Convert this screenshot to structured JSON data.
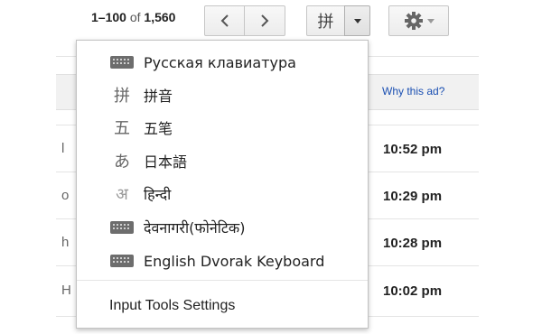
{
  "pager": {
    "range": "1–100",
    "of": "of",
    "total": "1,560"
  },
  "ime_button": {
    "glyph": "拼",
    "icon": "pinyin-ime-icon"
  },
  "settings_button": {
    "icon": "gear-icon"
  },
  "list": {
    "why_ad": "Why this ad?",
    "times": [
      "10:52 pm",
      "10:29 pm",
      "10:28 pm",
      "10:02 pm"
    ],
    "fragments": [
      "l",
      "o",
      "h",
      "H"
    ]
  },
  "menu": {
    "items": [
      {
        "icon": "keyboard-icon",
        "label": "Русская клавиатура"
      },
      {
        "icon": "pinyin-icon",
        "glyph": "拼",
        "label": "拼音"
      },
      {
        "icon": "wubi-icon",
        "glyph": "五",
        "label": "五笔"
      },
      {
        "icon": "hiragana-icon",
        "glyph": "あ",
        "label": "日本語"
      },
      {
        "icon": "devanagari-icon",
        "glyph": "अ",
        "label": "हिन्दी"
      },
      {
        "icon": "keyboard-icon",
        "label": "देवनागरी(फोनेटिक)"
      },
      {
        "icon": "keyboard-icon",
        "label": "English Dvorak Keyboard"
      }
    ],
    "settings_label": "Input Tools Settings"
  },
  "colors": {
    "link": "#1a4fb2",
    "menu_border": "#c2c2c2",
    "button_bg": "#f4f4f4"
  }
}
